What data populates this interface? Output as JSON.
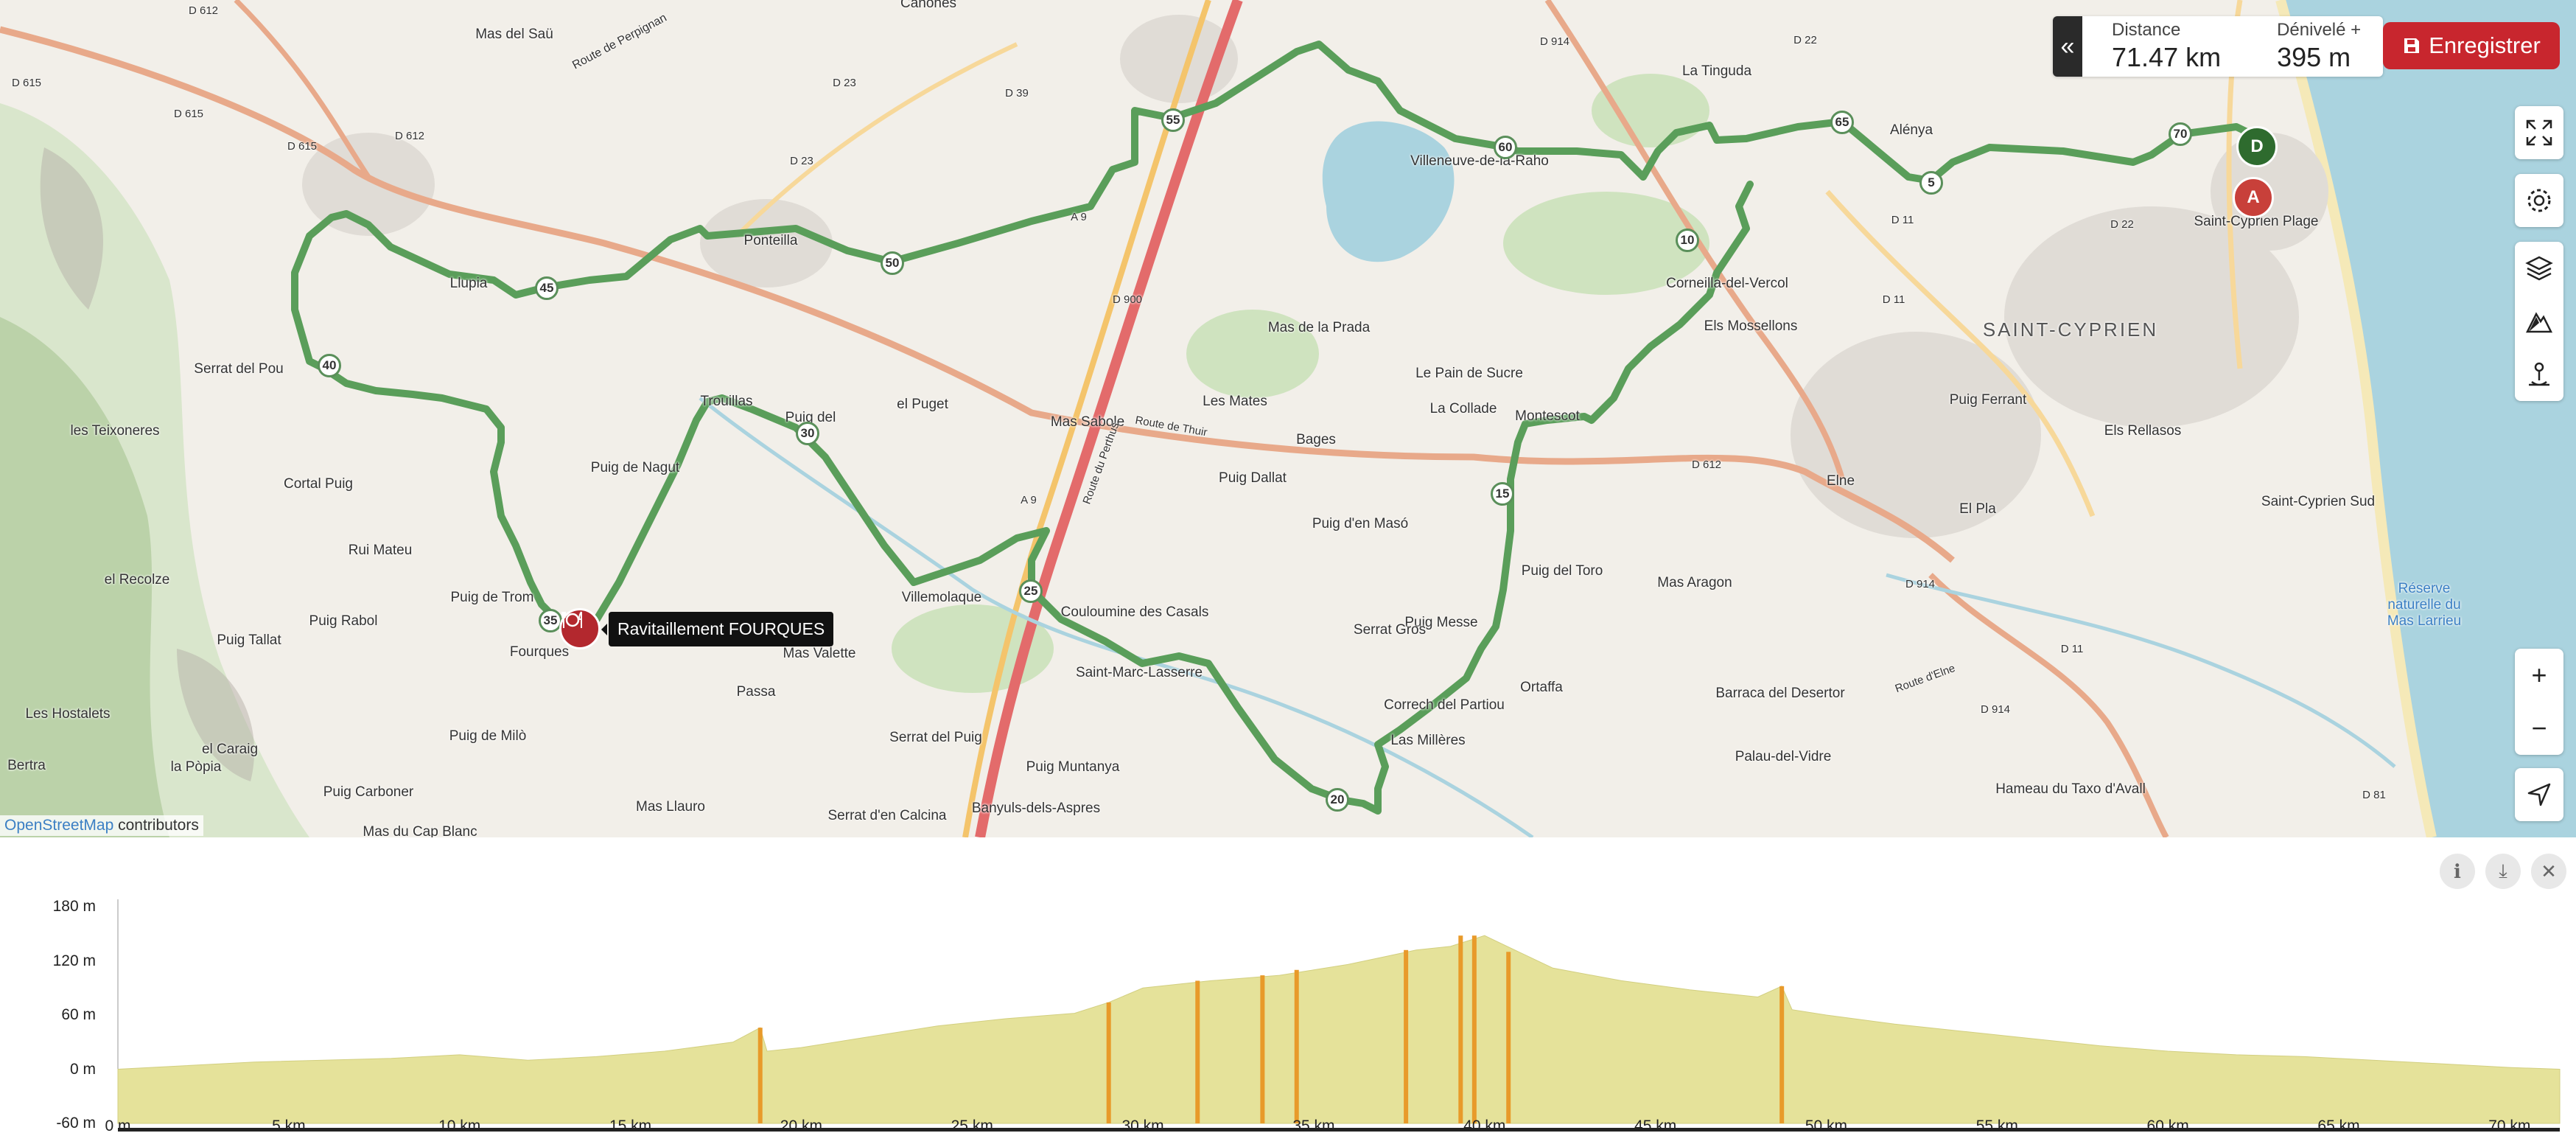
{
  "stats": {
    "distance_label": "Distance",
    "distance_value": "71.47 km",
    "elevation_label": "Dénivelé +",
    "elevation_value": "395 m"
  },
  "save_label": "Enregistrer",
  "attribution": {
    "link": "OpenStreetMap",
    "text": " contributors"
  },
  "tooltip": "Ravitaillement FOURQUES",
  "pins": {
    "start": "D",
    "end": "A"
  },
  "km_markers": [
    {
      "label": "5"
    },
    {
      "label": "10"
    },
    {
      "label": "15"
    },
    {
      "label": "20"
    },
    {
      "label": "25"
    },
    {
      "label": "30"
    },
    {
      "label": "35"
    },
    {
      "label": "40"
    },
    {
      "label": "45"
    },
    {
      "label": "50"
    },
    {
      "label": "55"
    },
    {
      "label": "60"
    },
    {
      "label": "65"
    },
    {
      "label": "70"
    }
  ],
  "places": [
    "Mas del Saü",
    "Route de Perpignan",
    "D 612",
    "D 615",
    "D 615",
    "D 615",
    "D 612",
    "D 23",
    "D 39",
    "D 23",
    "Canohès",
    "La Tinguda",
    "D 914",
    "D 22",
    "Alénya",
    "D 22",
    "D 11",
    "D 11",
    "Saint-Cyprien Plage",
    "SAINT-CYPRIEN",
    "Villeneuve-de-la-Raho",
    "Serrat del Pou",
    "les Teixoneres",
    "Cortal Puig",
    "Rui Mateu",
    "el Recolze",
    "Puig Tallat",
    "Puig Rabol",
    "Puig de Trom",
    "Fourques",
    "Les Hostalets",
    "Bertra",
    "el Caraig",
    "la Pòpia",
    "Puig Carboner",
    "Puig de Milò",
    "Mas Llauro",
    "Mas du Cap Blanc",
    "Puig de Nagut",
    "Trouillas",
    "Puig del",
    "el Puget",
    "Mas Sabole",
    "Route de Thuir",
    "Les Mates",
    "Bages",
    "Puig Dallat",
    "Puig d'en Masó",
    "Mas de la Prada",
    "Le Pain de Sucre",
    "La Collade",
    "Montescot",
    "Els Mossellons",
    "Corneilla-del-Vercol",
    "Elne",
    "D 612",
    "El Pla",
    "Puig Ferrant",
    "Els Rellasos",
    "Saint-Cyprien Sud",
    "Réserve naturelle du Mas Larrieu",
    "Mas Aragon",
    "Puig del Toro",
    "Couloumine des Casals",
    "Villemolaque",
    "Mas Valette",
    "Passa",
    "Saint-Marc-Lasserre",
    "Serrat del Puig",
    "Puig Muntanya",
    "Banyuls-dels-Aspres",
    "Serrat d'en Calcina",
    "Correch del Partiou",
    "Las Millères",
    "Ortaffa",
    "Barraca del Desertor",
    "Palau-del-Vidre",
    "Hameau du Taxo d'Avall",
    "D 914",
    "D 914",
    "D 11",
    "D 81",
    "Route d'Elne",
    "A 9",
    "A 9",
    "D 900",
    "Route du Perthus",
    "Ponteilla",
    "Puig Messe",
    "Serrat Gros",
    "Llupia"
  ],
  "profile": {
    "y_ticks": [
      "180 m",
      "120 m",
      "60 m",
      "0 m",
      "-60 m"
    ],
    "x_ticks": [
      "0 m",
      "5 km",
      "10 km",
      "15 km",
      "20 km",
      "25 km",
      "30 km",
      "35 km",
      "40 km",
      "45 km",
      "50 km",
      "55 km",
      "60 km",
      "65 km",
      "70 km"
    ]
  },
  "chart_data": {
    "type": "area",
    "xlabel": "",
    "ylabel": "",
    "xlim_km": [
      0,
      71.47
    ],
    "ylim_m": [
      -60,
      180
    ],
    "x_km": [
      0,
      2,
      4,
      6,
      8,
      10,
      12,
      14,
      16,
      18,
      18.8,
      19,
      20,
      22,
      24,
      26,
      28,
      29,
      30,
      32,
      34,
      35,
      36,
      37,
      38,
      39,
      40,
      41,
      42,
      44,
      46,
      48,
      48.7,
      49,
      50,
      52,
      54,
      56,
      58,
      60,
      62,
      64,
      66,
      68,
      70,
      71.47
    ],
    "elevation_m": [
      0,
      4,
      8,
      10,
      12,
      16,
      10,
      14,
      20,
      30,
      46,
      20,
      24,
      36,
      48,
      56,
      62,
      74,
      90,
      98,
      104,
      110,
      116,
      124,
      132,
      136,
      148,
      130,
      112,
      98,
      88,
      80,
      92,
      66,
      60,
      50,
      42,
      34,
      26,
      20,
      16,
      14,
      10,
      6,
      2,
      0
    ],
    "legend": "top-right"
  },
  "colors": {
    "route": "#5a9e5a",
    "pin_start": "#2e6b2e",
    "pin_end": "#c8403a",
    "save": "#c8262e",
    "profile_fill": "#e5e29a",
    "steep": "#e89a2a"
  }
}
